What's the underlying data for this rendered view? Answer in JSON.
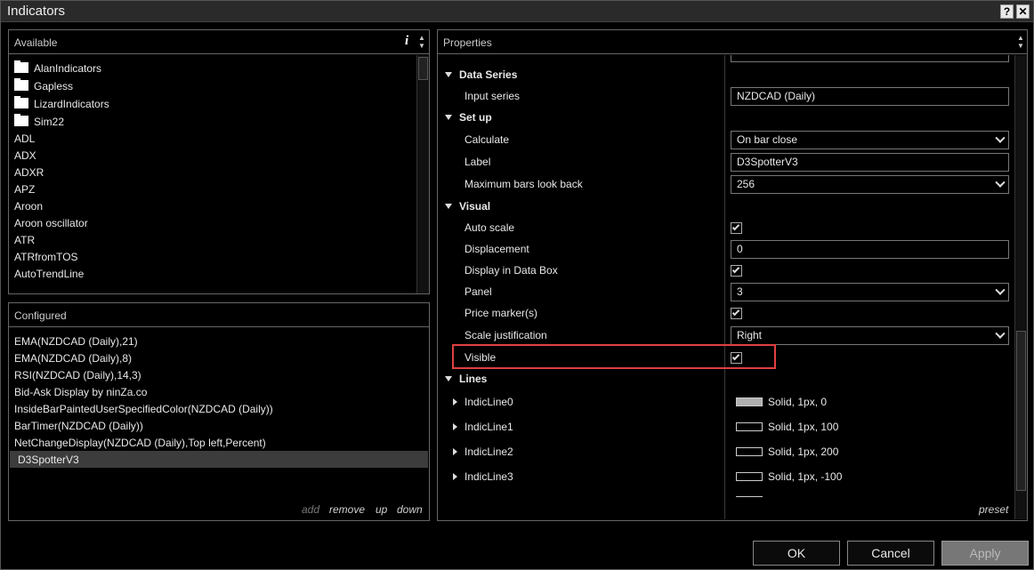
{
  "window": {
    "title": "Indicators",
    "help_label": "?",
    "close_label": "✕"
  },
  "available": {
    "header": "Available",
    "info_label": "i",
    "folders": [
      "AlanIndicators",
      "Gapless",
      "LizardIndicators",
      "Sim22"
    ],
    "items": [
      "ADL",
      "ADX",
      "ADXR",
      "APZ",
      "Aroon",
      "Aroon oscillator",
      "ATR",
      "ATRfromTOS",
      "AutoTrendLine"
    ]
  },
  "configured": {
    "header": "Configured",
    "items": [
      "EMA(NZDCAD (Daily),21)",
      "EMA(NZDCAD (Daily),8)",
      "RSI(NZDCAD (Daily),14,3)",
      "Bid-Ask Display by ninZa.co",
      "InsideBarPaintedUserSpecifiedColor(NZDCAD (Daily))",
      "BarTimer(NZDCAD (Daily))",
      "NetChangeDisplay(NZDCAD (Daily),Top left,Percent)",
      "D3SpotterV3"
    ],
    "selected": "D3SpotterV3",
    "links": {
      "add": "add",
      "remove": "remove",
      "up": "up",
      "down": "down"
    }
  },
  "properties": {
    "header": "Properties",
    "preset_label": "preset",
    "data_series": {
      "title": "Data Series",
      "input_series_label": "Input series",
      "input_series_value": "NZDCAD (Daily)"
    },
    "setup": {
      "title": "Set up",
      "calculate_label": "Calculate",
      "calculate_value": "On bar close",
      "label_label": "Label",
      "label_value": "D3SpotterV3",
      "max_bars_label": "Maximum bars look back",
      "max_bars_value": "256"
    },
    "visual": {
      "title": "Visual",
      "auto_scale_label": "Auto scale",
      "auto_scale": true,
      "displacement_label": "Displacement",
      "displacement_value": "0",
      "display_in_data_box_label": "Display in Data Box",
      "display_in_data_box": true,
      "panel_label": "Panel",
      "panel_value": "3",
      "price_marker_label": "Price marker(s)",
      "price_marker": true,
      "scale_justification_label": "Scale justification",
      "scale_justification_value": "Right",
      "visible_label": "Visible",
      "visible": true
    },
    "lines": {
      "title": "Lines",
      "items": [
        {
          "name": "IndicLine0",
          "value": "Solid, 1px, 0",
          "color": "#b0b0b0"
        },
        {
          "name": "IndicLine1",
          "value": "Solid, 1px, 100",
          "color": "#000000"
        },
        {
          "name": "IndicLine2",
          "value": "Solid, 1px, 200",
          "color": "#000000"
        },
        {
          "name": "IndicLine3",
          "value": "Solid, 1px, -100",
          "color": "#000000"
        }
      ]
    }
  },
  "buttons": {
    "ok": "OK",
    "cancel": "Cancel",
    "apply": "Apply"
  },
  "colors": {
    "highlight": "#e04040",
    "selected_row": "#3c3c3c"
  }
}
